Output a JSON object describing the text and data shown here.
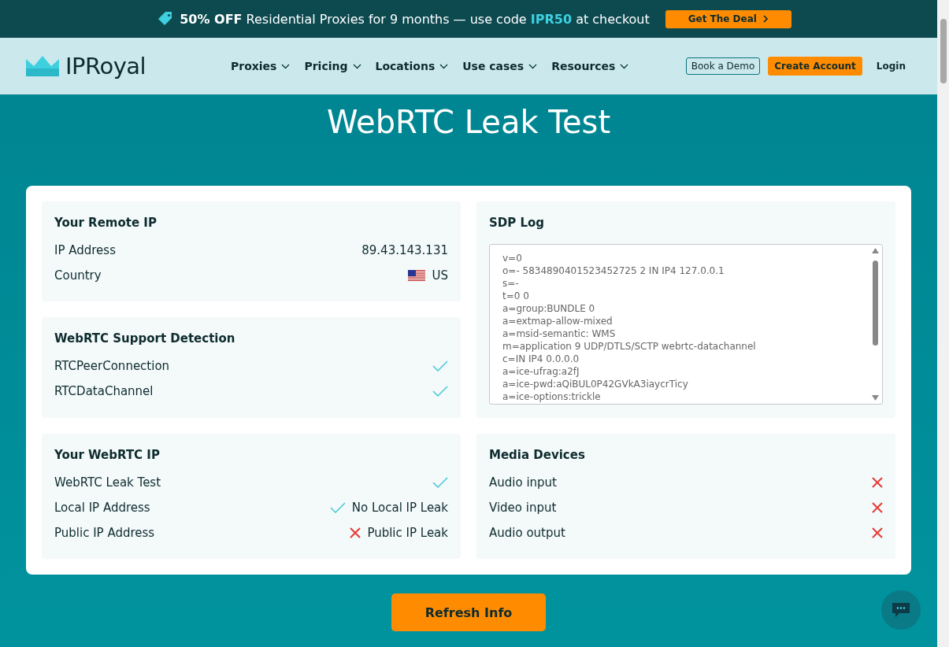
{
  "promo": {
    "text": "**50% OFF** Residential Proxies for 9 months — use code",
    "code": "IPR50",
    "tail": "at checkout",
    "button": "Get The Deal"
  },
  "nav": {
    "logo": "IPRoyal",
    "menu": [
      "Proxies",
      "Pricing",
      "Locations",
      "Use cases",
      "Resources"
    ],
    "demo": "Book a Demo",
    "create": "Create Account",
    "login": "Login"
  },
  "title": "WebRTC Leak Test",
  "remote_ip": {
    "title": "Your Remote IP",
    "rows": [
      {
        "kind": "text",
        "label": "IP Address",
        "value": "89.43.143.131"
      },
      {
        "kind": "country",
        "label": "Country",
        "value": "US"
      }
    ]
  },
  "support": {
    "title": "WebRTC Support Detection",
    "rows": [
      {
        "kind": "status",
        "label": "RTCPeerConnection",
        "passed": true
      },
      {
        "kind": "status",
        "label": "RTCDataChannel",
        "passed": true
      }
    ]
  },
  "webrtc_ip": {
    "title": "Your WebRTC IP",
    "rows": [
      {
        "kind": "status",
        "label": "WebRTC Leak Test",
        "passed": true
      },
      {
        "kind": "status",
        "label": "Local IP Address",
        "passed": true,
        "value": "No Local IP Leak"
      },
      {
        "kind": "status",
        "label": "Public IP Address",
        "passed": false,
        "value": "Public IP Leak"
      }
    ]
  },
  "sdp_log": {
    "title": "SDP Log",
    "lines": [
      "v=0",
      "o=- 5834890401523452725 2 IN IP4 127.0.0.1",
      "s=-",
      "t=0 0",
      "a=group:BUNDLE 0",
      "a=extmap-allow-mixed",
      "a=msid-semantic: WMS",
      "m=application 9 UDP/DTLS/SCTP webrtc-datachannel",
      "c=IN IP4 0.0.0.0",
      "a=ice-ufrag:a2fJ",
      "a=ice-pwd:aQiBUL0P42GVkA3iaycrTicy",
      "a=ice-options:trickle"
    ]
  },
  "media": {
    "title": "Media Devices",
    "rows": [
      {
        "kind": "status",
        "label": "Audio input",
        "passed": false
      },
      {
        "kind": "status",
        "label": "Video input",
        "passed": false
      },
      {
        "kind": "status",
        "label": "Audio output",
        "passed": false
      }
    ]
  },
  "refresh": "Refresh Info"
}
